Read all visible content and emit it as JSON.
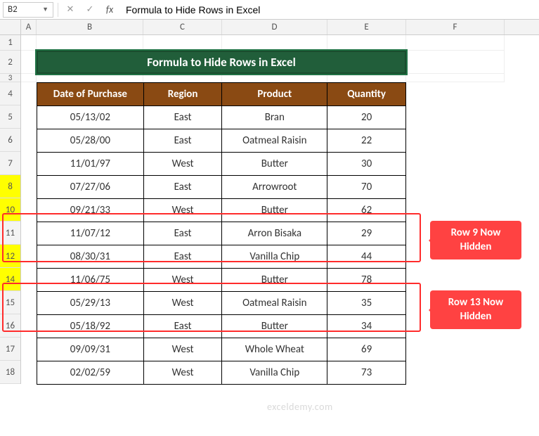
{
  "name_box": "B2",
  "formula_value": "Formula to Hide Rows in Excel",
  "columns": [
    "A",
    "B",
    "C",
    "D",
    "E",
    "F"
  ],
  "row_numbers": [
    "1",
    "2",
    "3",
    "4",
    "5",
    "6",
    "7",
    "8",
    "10",
    "11",
    "12",
    "14",
    "15",
    "16",
    "17",
    "18"
  ],
  "highlighted_rows": [
    "8",
    "10",
    "12",
    "14"
  ],
  "title": "Formula to Hide Rows in Excel",
  "table": {
    "headers": [
      "Date of Purchase",
      "Region",
      "Product",
      "Quantity"
    ],
    "rows": [
      [
        "05/13/02",
        "East",
        "Bran",
        "20"
      ],
      [
        "05/28/00",
        "East",
        "Oatmeal Raisin",
        "22"
      ],
      [
        "11/01/97",
        "West",
        "Butter",
        "30"
      ],
      [
        "07/27/06",
        "East",
        "Arrowroot",
        "70"
      ],
      [
        "09/21/33",
        "West",
        "Butter",
        "62"
      ],
      [
        "11/07/12",
        "East",
        "Arron Bisaka",
        "29"
      ],
      [
        "08/30/31",
        "East",
        "Vanilla Chip",
        "44"
      ],
      [
        "11/06/75",
        "West",
        "Butter",
        "78"
      ],
      [
        "05/29/13",
        "West",
        "Oatmeal Raisin",
        "35"
      ],
      [
        "05/18/92",
        "East",
        "Butter",
        "34"
      ],
      [
        "09/09/31",
        "West",
        "Whole Wheat",
        "69"
      ],
      [
        "02/02/59",
        "West",
        "Vanilla Chip",
        "73"
      ]
    ]
  },
  "callouts": {
    "c1": "Row 9 Now Hidden",
    "c2": "Row 13 Now Hidden"
  },
  "watermark": "exceldemy.com",
  "fx_label": "fx",
  "cancel_label": "✕",
  "confirm_label": "✓"
}
